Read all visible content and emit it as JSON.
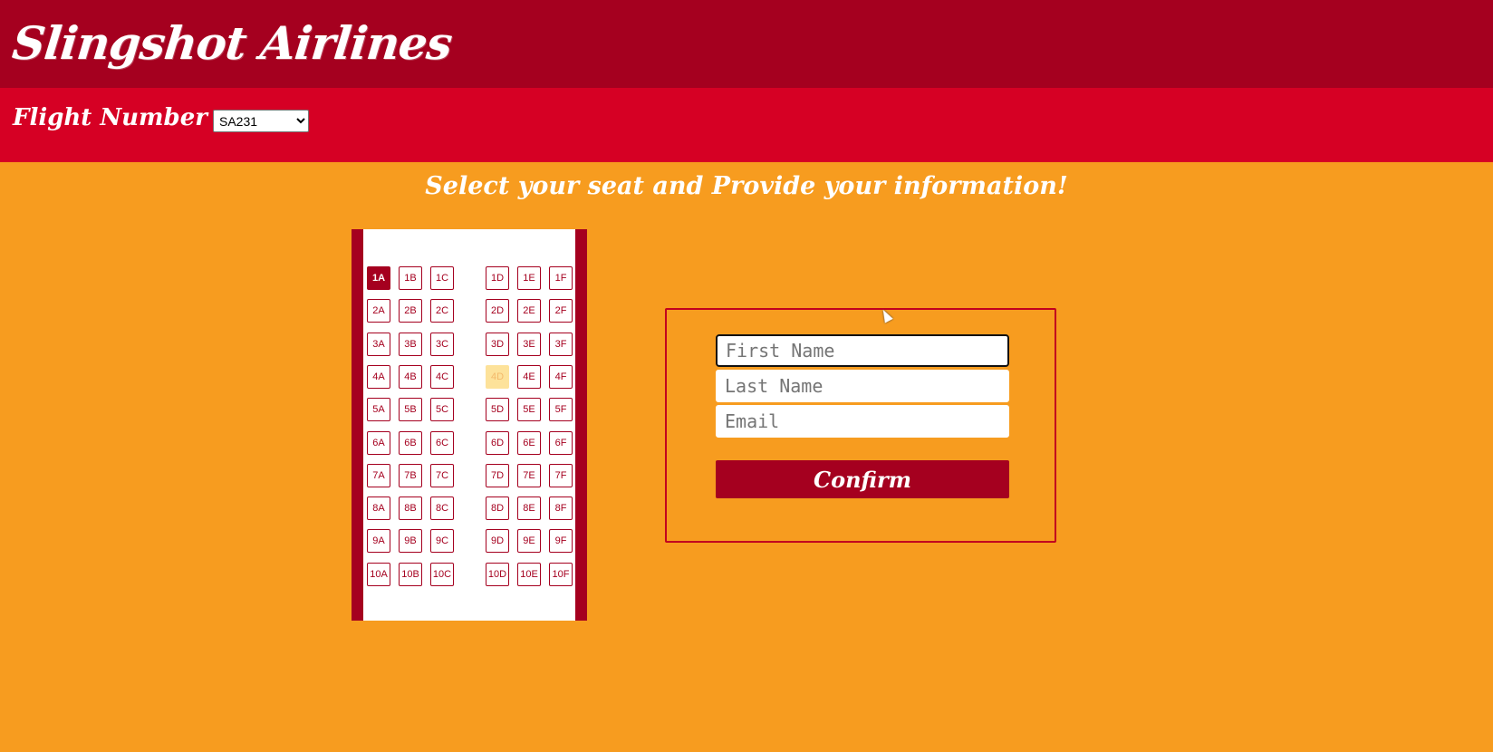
{
  "header": {
    "brand": "Slingshot Airlines"
  },
  "flight": {
    "label": "Flight Number",
    "selected": "SA231",
    "options": [
      "SA231"
    ]
  },
  "heading": "Select your seat and Provide your information!",
  "seat_map": {
    "rows": [
      "1",
      "2",
      "3",
      "4",
      "5",
      "6",
      "7",
      "8",
      "9",
      "10"
    ],
    "columns": [
      "A",
      "B",
      "C",
      "D",
      "E",
      "F"
    ],
    "selected_seat": "1A",
    "unavailable_seats": [
      "4D"
    ]
  },
  "form": {
    "first_name_placeholder": "First Name",
    "last_name_placeholder": "Last Name",
    "email_placeholder": "Email",
    "confirm_label": "Confirm"
  },
  "colors": {
    "header_dark": "#a5001f",
    "header_red": "#d60024",
    "background_orange": "#f79c1f",
    "seat_taken": "#fde29a"
  }
}
